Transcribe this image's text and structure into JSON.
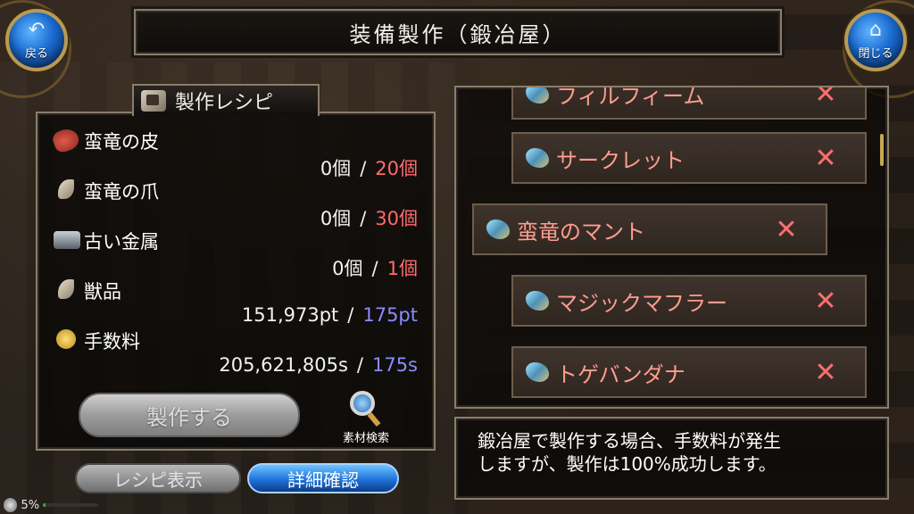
{
  "header": {
    "title": "装備製作（鍛冶屋）",
    "back_label": "戻る",
    "close_label": "閉じる"
  },
  "recipe_panel": {
    "tab_label": "製作レシピ",
    "materials": [
      {
        "name": "蛮竜の皮",
        "have": "0個",
        "need": "20個",
        "icon": "hide-icon",
        "need_color": "#ff6b6b"
      },
      {
        "name": "蛮竜の爪",
        "have": "0個",
        "need": "30個",
        "icon": "claw-icon",
        "need_color": "#ff6b6b"
      },
      {
        "name": "古い金属",
        "have": "0個",
        "need": "1個",
        "icon": "metal-icon",
        "need_color": "#ff6b6b"
      },
      {
        "name": "獣品",
        "have": "151,973pt",
        "need": "175pt",
        "icon": "claw-icon",
        "need_color": "#8a8cff"
      },
      {
        "name": "手数料",
        "have": "205,621,805s",
        "need": "175s",
        "icon": "coin-icon",
        "need_color": "#8a8cff"
      }
    ],
    "separator": "/",
    "craft_label": "製作する",
    "search_label": "素材検索",
    "recipe_view_label": "レシピ表示",
    "detail_label": "詳細確認"
  },
  "status": {
    "percent_label": "5%",
    "percent_value": 5
  },
  "item_list": {
    "items": [
      {
        "name": "フィルフィーム",
        "mark": "✕"
      },
      {
        "name": "サークレット",
        "mark": "✕"
      },
      {
        "name": "蛮竜のマント",
        "mark": "✕"
      },
      {
        "name": "マジックマフラー",
        "mark": "✕"
      },
      {
        "name": "トゲバンダナ",
        "mark": "✕"
      }
    ]
  },
  "description": {
    "line1": "鍛冶屋で製作する場合、手数料が発生",
    "line2": "しますが、製作は100%成功します。"
  }
}
